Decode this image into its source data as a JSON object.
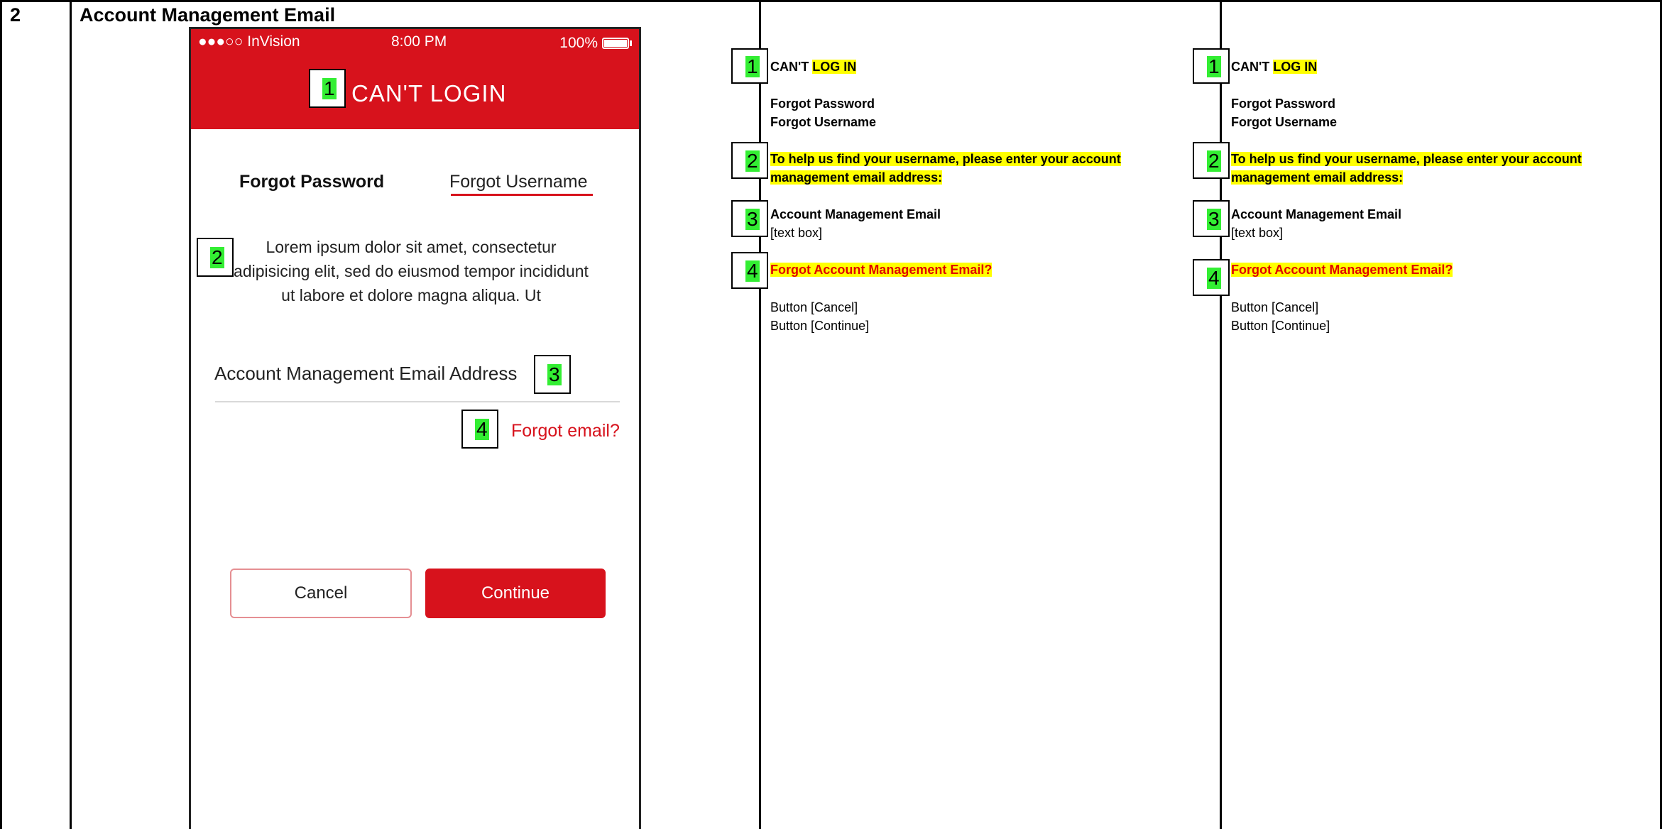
{
  "row": {
    "number": "2",
    "title": "Account Management Email"
  },
  "phone": {
    "status": {
      "carrier": "●●●○○ InVision",
      "time": "8:00 PM",
      "battery": "100%"
    },
    "header_title": "CAN'T LOGIN",
    "tabs": [
      {
        "label": "Forgot Password"
      },
      {
        "label": "Forgot Username"
      }
    ],
    "description": "Lorem ipsum dolor sit amet, consectetur adipisicing elit, sed do eiusmod tempor incididunt ut labore et dolore magna aliqua. Ut",
    "email_label": "Account Management Email Address",
    "forgot_email": "Forgot email?",
    "cancel_button": "Cancel",
    "continue_button": "Continue",
    "markers": [
      "1",
      "2",
      "3",
      "4"
    ]
  },
  "spec_columns": [
    {
      "m1": "1",
      "m2": "2",
      "m3": "3",
      "m4": "4",
      "title_prefix": "CAN'T ",
      "title_highlight": "LOG IN",
      "tab1": "Forgot Password",
      "tab2": "Forgot Username",
      "help_text": "To help us find your username, please enter your account management email address:",
      "field_label": "Account Management Email",
      "field_type": "[text box]",
      "forgot_link": "Forgot Account Management Email?",
      "button1": "Button [Cancel]",
      "button2": "Button [Continue]"
    },
    {
      "m1": "1",
      "m2": "2",
      "m3": "3",
      "m4": "4",
      "title_prefix": "CAN'T ",
      "title_highlight": "LOG IN",
      "tab1": "Forgot Password",
      "tab2": "Forgot Username",
      "help_text": "To help us find your username, please enter your account management email address:",
      "field_label": "Account Management Email",
      "field_type": "[text box]",
      "forgot_link": "Forgot Account Management Email?",
      "button1": "Button [Cancel]",
      "button2": "Button [Continue]"
    }
  ],
  "colors": {
    "brand_red": "#d7121c",
    "highlight_yellow": "#ffff00",
    "marker_green": "#33ee33"
  }
}
